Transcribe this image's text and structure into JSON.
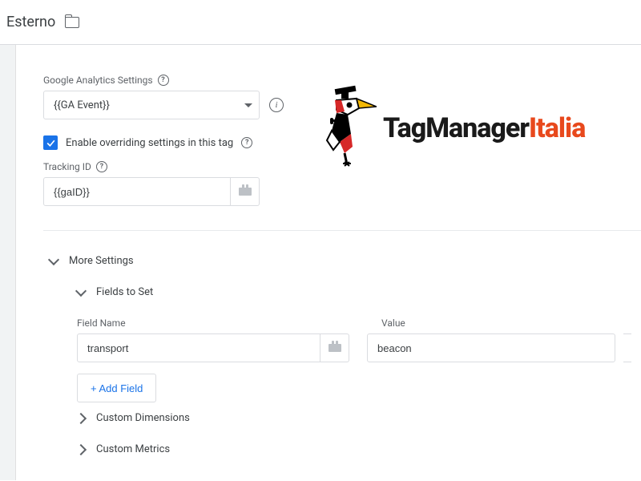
{
  "topbar": {
    "title": "Esterno"
  },
  "ga_settings": {
    "label": "Google Analytics Settings",
    "selected": "{{GA Event}}"
  },
  "override": {
    "label": "Enable overriding settings in this tag"
  },
  "tracking_id": {
    "label": "Tracking ID",
    "value": "{{gaID}}"
  },
  "more_settings": {
    "label": "More Settings"
  },
  "fields_to_set": {
    "label": "Fields to Set",
    "col_field_name": "Field Name",
    "col_value": "Value",
    "rows": [
      {
        "name": "transport",
        "value": "beacon"
      }
    ],
    "add_button": "+ Add Field"
  },
  "custom_dimensions": {
    "label": "Custom Dimensions"
  },
  "custom_metrics": {
    "label": "Custom Metrics"
  },
  "logo": {
    "text_main": "TagManager",
    "text_accent": "Italia"
  }
}
